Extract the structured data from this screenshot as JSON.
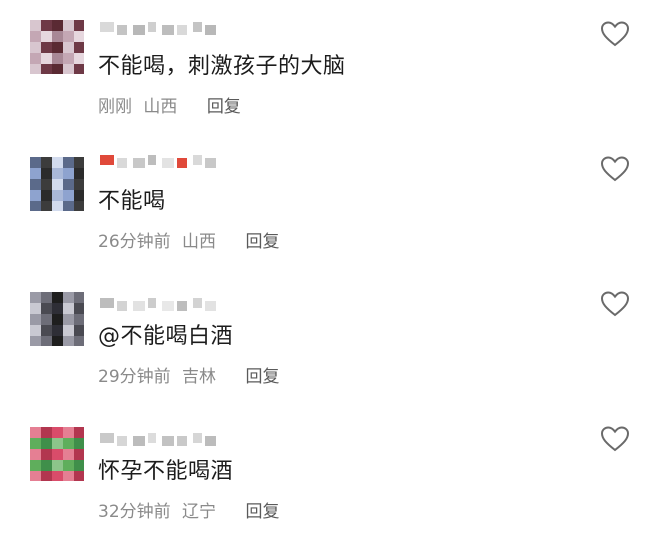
{
  "comments": [
    {
      "text": "不能喝，刺激孩子的大脑",
      "time": "刚刚",
      "location": "山西",
      "reply_label": "回复",
      "avatar_colors": [
        "#d8c6cf",
        "#a88896",
        "#6e3946",
        "#c4a7b4",
        "#5a2a33",
        "#e6d7de"
      ],
      "username_colors": [
        "#d9d9d9",
        "#c4c4c4",
        "#b8b8b8",
        "#cfcfcf",
        "#bdbdbd"
      ]
    },
    {
      "text": "不能喝",
      "time": "26分钟前",
      "location": "山西",
      "reply_label": "回复",
      "avatar_colors": [
        "#2b2b2b",
        "#5b6a8a",
        "#a9b8d8",
        "#3c3c3c",
        "#8ea3cf",
        "#d2dbee"
      ],
      "username_colors": [
        "#e0493a",
        "#d9d9d9",
        "#c8c8c8",
        "#bdbdbd",
        "#e3e3e3"
      ]
    },
    {
      "text": "@不能喝白酒",
      "time": "29分钟前",
      "location": "吉林",
      "reply_label": "回复",
      "avatar_colors": [
        "#1e1e1e",
        "#4a4a52",
        "#9a9aa6",
        "#2e2e36",
        "#6d6d78",
        "#c9c9d2"
      ],
      "username_colors": [
        "#bdbdbd",
        "#d3d3d3",
        "#e2e2e2",
        "#cccccc",
        "#e8e8e8"
      ]
    },
    {
      "text": "怀孕不能喝酒",
      "time": "32分钟前",
      "location": "辽宁",
      "reply_label": "回复",
      "avatar_colors": [
        "#5fae5c",
        "#d94c6a",
        "#3f8f4a",
        "#e57f93",
        "#8cc58a",
        "#b2364f"
      ],
      "username_colors": [
        "#c9c9c9",
        "#d6d6d6",
        "#bcbcbc",
        "#dcdcdc",
        "#c2c2c2"
      ]
    }
  ],
  "icons": {
    "like": "heart-outline-icon"
  },
  "colors": {
    "text_primary": "#1c1c1c",
    "text_secondary": "#8a8a8a",
    "reply": "#5a5a5a",
    "icon_stroke": "#6a6a6a"
  }
}
